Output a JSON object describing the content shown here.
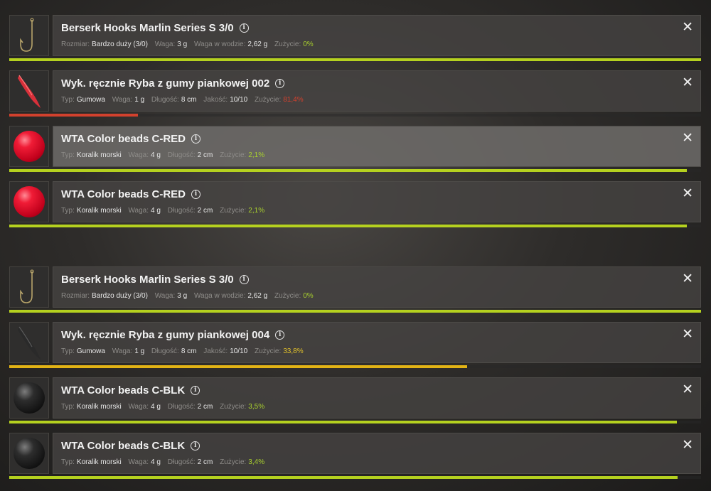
{
  "colors": {
    "wear_full": "#b5d11f",
    "wear_red": "#d2412d",
    "wear_yellow": "#e2b315"
  },
  "items": [
    {
      "title": "Berserk Hooks Marlin Series S 3/0",
      "icon": "hook-icon",
      "stats": [
        {
          "label": "Rozmiar:",
          "value": "Bardzo duży (3/0)"
        },
        {
          "label": "Waga:",
          "value": "3 g"
        },
        {
          "label": "Waga w wodzie:",
          "value": "2,62 g"
        },
        {
          "label": "Zużycie:",
          "value": "0%"
        }
      ],
      "condition": 1.0,
      "wear_color": "#b5d11f"
    },
    {
      "title": "Wyk. ręcznie Ryba z gumy piankowej 002",
      "icon": "red-rubber-fish-icon",
      "stats": [
        {
          "label": "Typ:",
          "value": "Gumowa"
        },
        {
          "label": "Waga:",
          "value": "1 g"
        },
        {
          "label": "Długość:",
          "value": "8 cm"
        },
        {
          "label": "Jakość:",
          "value": "10/10"
        },
        {
          "label": "Zużycie:",
          "value": "81,4%"
        }
      ],
      "condition": 0.186,
      "wear_color": "#d2412d"
    },
    {
      "title": "WTA Color beads C-RED",
      "icon": "red-bead-icon",
      "stats": [
        {
          "label": "Typ:",
          "value": "Koralik morski"
        },
        {
          "label": "Waga:",
          "value": "4 g"
        },
        {
          "label": "Długość:",
          "value": "2 cm"
        },
        {
          "label": "Zużycie:",
          "value": "2,1%"
        }
      ],
      "condition": 0.979,
      "wear_color": "#b5d11f"
    },
    {
      "title": "WTA Color beads C-RED",
      "icon": "red-bead-icon",
      "stats": [
        {
          "label": "Typ:",
          "value": "Koralik morski"
        },
        {
          "label": "Waga:",
          "value": "4 g"
        },
        {
          "label": "Długość:",
          "value": "2 cm"
        },
        {
          "label": "Zużycie:",
          "value": "2,1%"
        }
      ],
      "condition": 0.979,
      "wear_color": "#b5d11f"
    },
    {
      "title": "Berserk Hooks Marlin Series S 3/0",
      "icon": "hook-icon",
      "stats": [
        {
          "label": "Rozmiar:",
          "value": "Bardzo duży (3/0)"
        },
        {
          "label": "Waga:",
          "value": "3 g"
        },
        {
          "label": "Waga w wodzie:",
          "value": "2,62 g"
        },
        {
          "label": "Zużycie:",
          "value": "0%"
        }
      ],
      "condition": 1.0,
      "wear_color": "#b5d11f"
    },
    {
      "title": "Wyk. ręcznie Ryba z gumy piankowej 004",
      "icon": "black-rubber-fish-icon",
      "stats": [
        {
          "label": "Typ:",
          "value": "Gumowa"
        },
        {
          "label": "Waga:",
          "value": "1 g"
        },
        {
          "label": "Długość:",
          "value": "8 cm"
        },
        {
          "label": "Jakość:",
          "value": "10/10"
        },
        {
          "label": "Zużycie:",
          "value": "33,8%"
        }
      ],
      "condition": 0.662,
      "wear_color": "#e2b315"
    },
    {
      "title": "WTA Color beads C-BLK",
      "icon": "black-bead-icon",
      "stats": [
        {
          "label": "Typ:",
          "value": "Koralik morski"
        },
        {
          "label": "Waga:",
          "value": "4 g"
        },
        {
          "label": "Długość:",
          "value": "2 cm"
        },
        {
          "label": "Zużycie:",
          "value": "3,5%"
        }
      ],
      "condition": 0.965,
      "wear_color": "#b5d11f"
    },
    {
      "title": "WTA Color beads C-BLK",
      "icon": "black-bead-icon",
      "stats": [
        {
          "label": "Typ:",
          "value": "Koralik morski"
        },
        {
          "label": "Waga:",
          "value": "4 g"
        },
        {
          "label": "Długość:",
          "value": "2 cm"
        },
        {
          "label": "Zużycie:",
          "value": "3,4%"
        }
      ],
      "condition": 0.966,
      "wear_color": "#b5d11f"
    }
  ],
  "info_glyph": "i",
  "close_glyph": "✕"
}
